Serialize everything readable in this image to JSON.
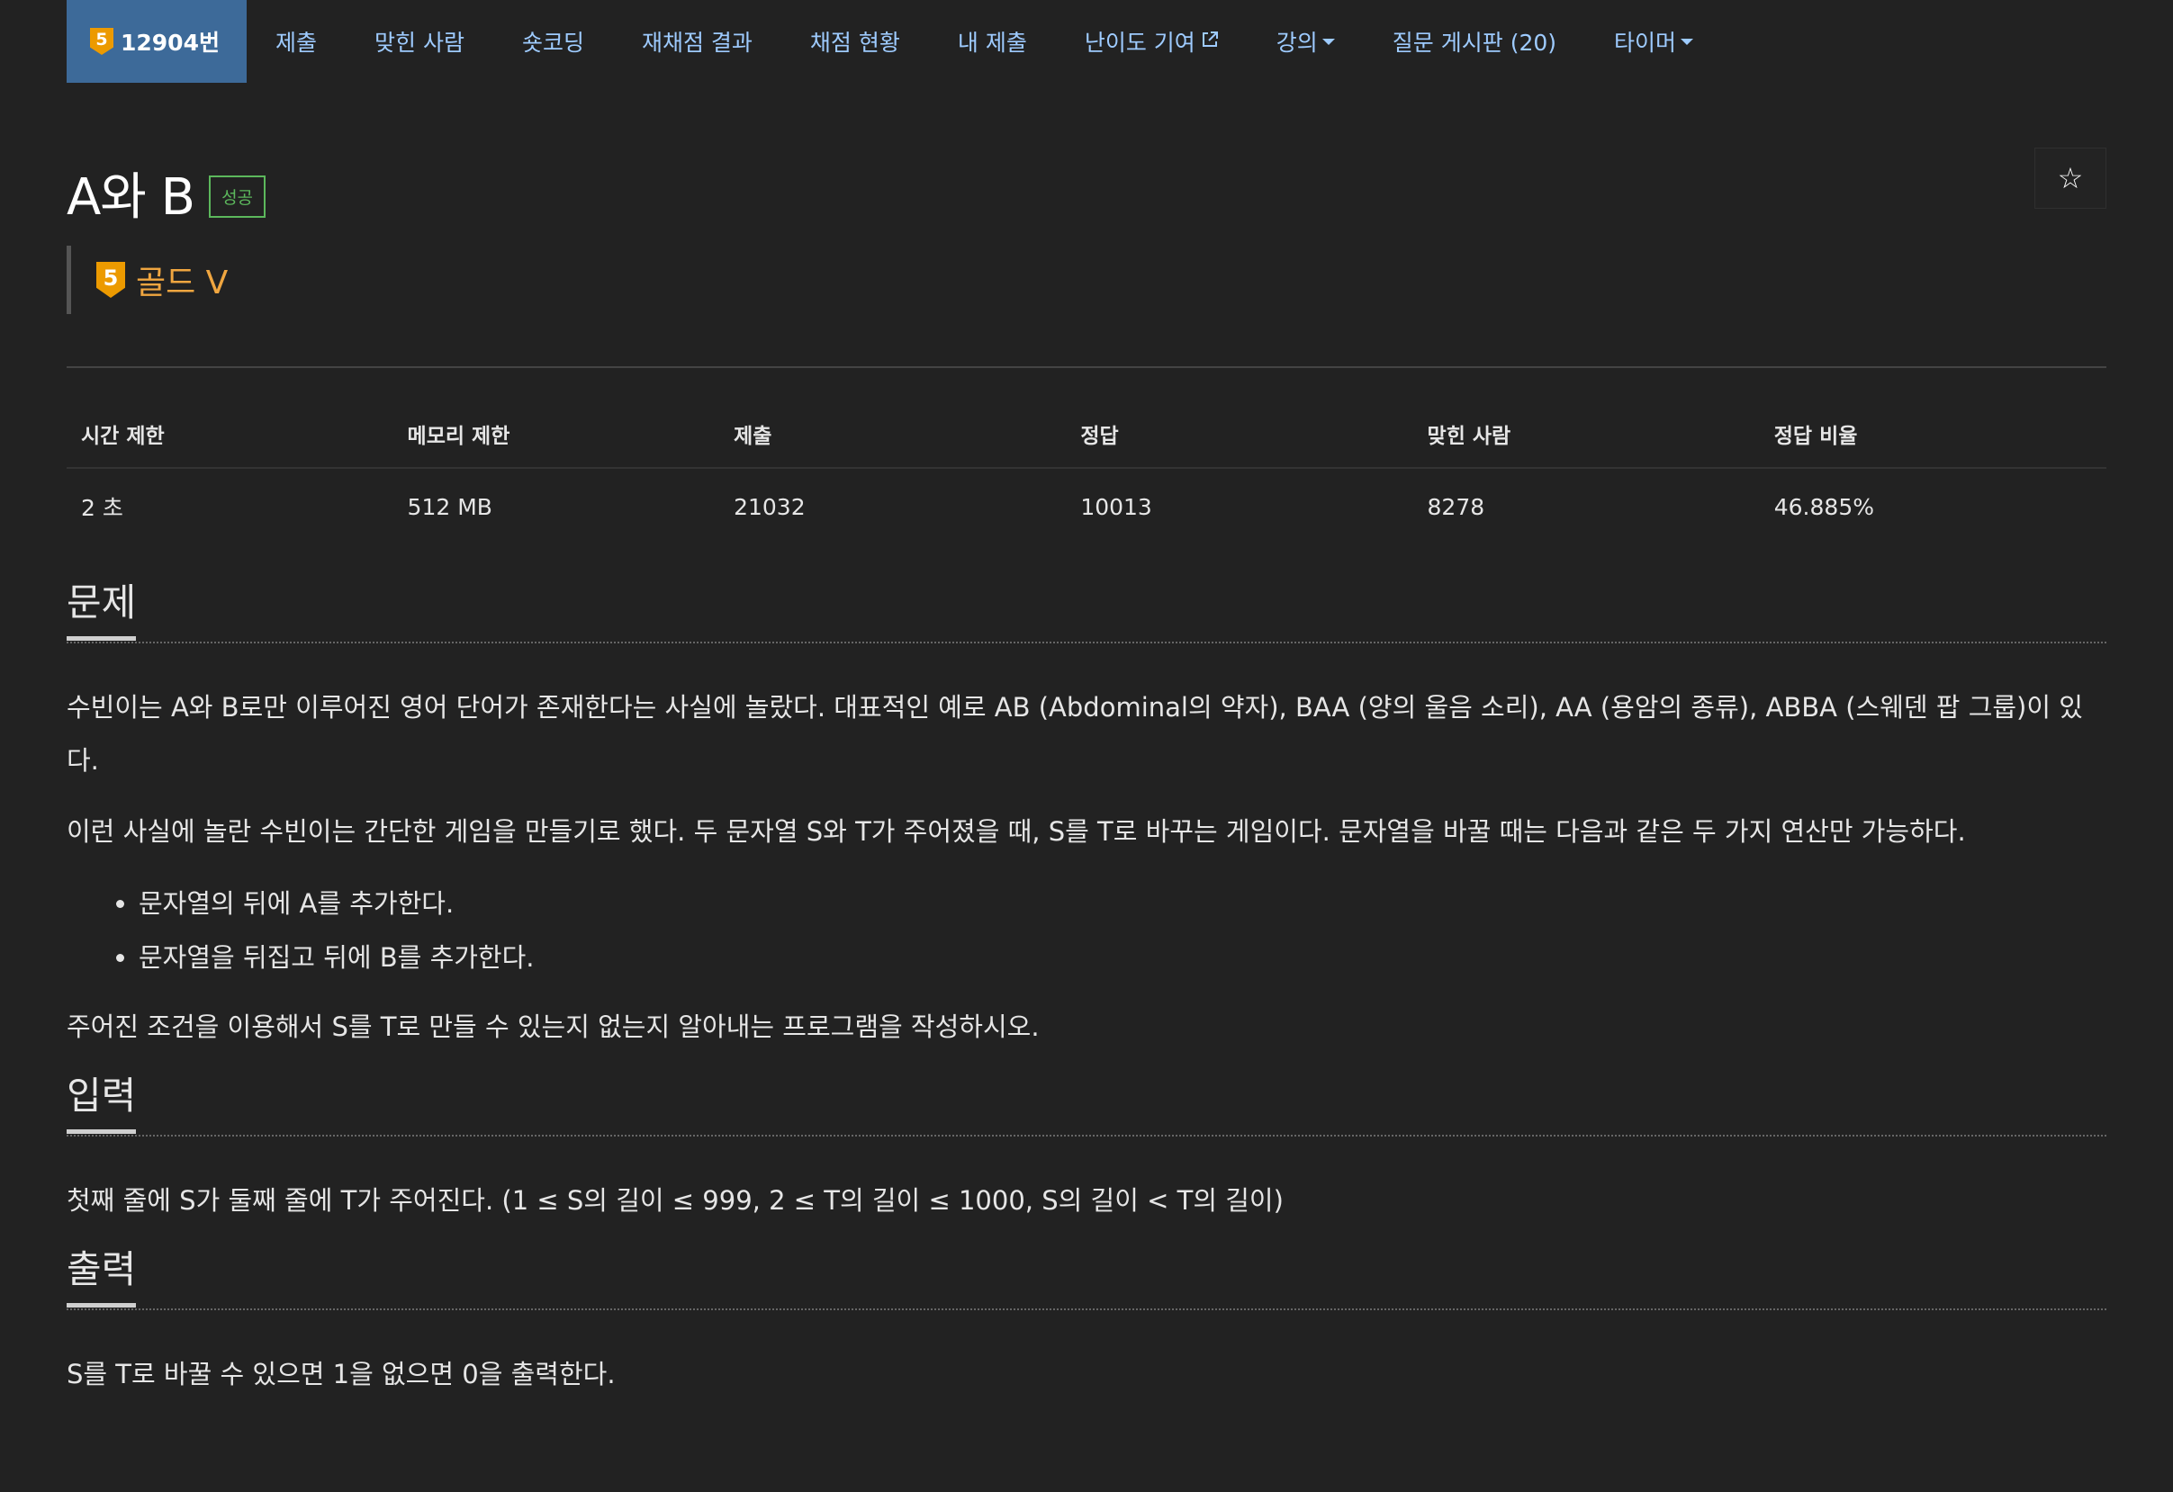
{
  "nav": {
    "active_tier_badge": "5",
    "active_label": "12904번",
    "items": [
      {
        "label": "제출"
      },
      {
        "label": "맞힌 사람"
      },
      {
        "label": "숏코딩"
      },
      {
        "label": "재채점 결과"
      },
      {
        "label": "채점 현황"
      },
      {
        "label": "내 제출"
      },
      {
        "label": "난이도 기여",
        "icon": "external-link-icon"
      },
      {
        "label": "강의",
        "icon": "caret-down-icon"
      },
      {
        "label": "질문 게시판 (20)"
      },
      {
        "label": "타이머",
        "icon": "caret-down-icon"
      }
    ]
  },
  "problem": {
    "title": "A와 B",
    "status": "성공",
    "tier_badge": "5",
    "tier_name": "골드 V",
    "star": "☆"
  },
  "info_table": {
    "headers": [
      "시간 제한",
      "메모리 제한",
      "제출",
      "정답",
      "맞힌 사람",
      "정답 비율"
    ],
    "values": [
      "2 초",
      "512 MB",
      "21032",
      "10013",
      "8278",
      "46.885%"
    ]
  },
  "sections": {
    "problem": {
      "title": "문제",
      "p1": "수빈이는 A와 B로만 이루어진 영어 단어가 존재한다는 사실에 놀랐다. 대표적인 예로 AB (Abdominal의 약자), BAA (양의 울음 소리), AA (용암의 종류), ABBA (스웨덴 팝 그룹)이 있다.",
      "p2": "이런 사실에 놀란 수빈이는 간단한 게임을 만들기로 했다. 두 문자열 S와 T가 주어졌을 때, S를 T로 바꾸는 게임이다. 문자열을 바꿀 때는 다음과 같은 두 가지 연산만 가능하다.",
      "bullets": [
        "문자열의 뒤에 A를 추가한다.",
        "문자열을 뒤집고 뒤에 B를 추가한다."
      ],
      "p3": "주어진 조건을 이용해서 S를 T로 만들 수 있는지 없는지 알아내는 프로그램을 작성하시오."
    },
    "input": {
      "title": "입력",
      "text": "첫째 줄에 S가 둘째 줄에 T가 주어진다. (1 ≤ S의 길이 ≤ 999, 2 ≤ T의 길이 ≤ 1000, S의 길이 < T의 길이)"
    },
    "output": {
      "title": "출력",
      "text": "S를 T로 바꿀 수 있으면 1을 없으면 0을 출력한다."
    }
  },
  "colors": {
    "background": "#222222",
    "nav_active": "#3d6a99",
    "link": "#9ecbff",
    "gold": "#ec9a00",
    "success": "#5cb85c"
  }
}
